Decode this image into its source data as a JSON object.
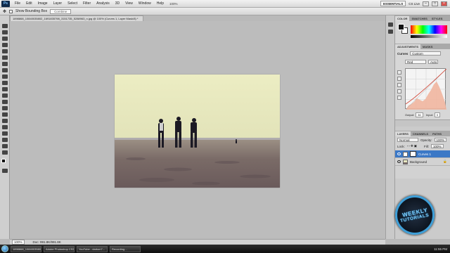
{
  "app": {
    "logo_text": "Ps",
    "menu": [
      "File",
      "Edit",
      "Image",
      "Layer",
      "Select",
      "Filter",
      "Analysis",
      "3D",
      "View",
      "Window",
      "Help"
    ],
    "zoom_display": "100%",
    "workspace_label": "ESSENTIALS",
    "cs_live": "CS Live"
  },
  "options_bar": {
    "show_bounding_box": "Show Bounding Box",
    "field_placeholder": "Combine"
  },
  "document": {
    "tab_title": "1898868_10840035802_1691835798_3151735_5288963_n.jpg @ 100% (Curves 1, Layer Mask/8) *"
  },
  "status_bar": {
    "zoom": "100%",
    "doc_info": "Doc: 991.8K/991.8K"
  },
  "panels": {
    "color_tabs": [
      "COLOR",
      "SWATCHES",
      "STYLES"
    ],
    "adjustment_tabs": [
      "ADJUSTMENTS",
      "MASKS"
    ],
    "curves_title": "Curves",
    "preset_label": "Custom",
    "channel_label": "Red",
    "auto_label": "Auto",
    "output_label": "Output:",
    "output_value": "36",
    "input_label": "Input:",
    "input_value": "0",
    "layers_tabs": [
      "LAYERS",
      "CHANNELS",
      "PATHS"
    ],
    "blend_mode": "Normal",
    "opacity_label": "Opacity:",
    "opacity_value": "100%",
    "lock_label": "Lock:",
    "fill_label": "Fill:",
    "fill_value": "100%",
    "layers": [
      {
        "name": "Curves 1",
        "selected": true
      },
      {
        "name": "Background",
        "selected": false
      }
    ]
  },
  "logo": {
    "line1": "WEEKLY",
    "line2": "TUTORIALS"
  },
  "taskbar": {
    "items": [
      "1898868_10840035802...",
      "Adobe Photoshop CS5",
      "YouTube - darkon7...",
      "Recording..."
    ],
    "clock": "11:55 PM"
  },
  "colors": {
    "sky_top": "#ecedc3",
    "sky_bottom": "#dfe0b4",
    "sand": "#7a6a68",
    "layer_selected": "#3b78c6"
  }
}
